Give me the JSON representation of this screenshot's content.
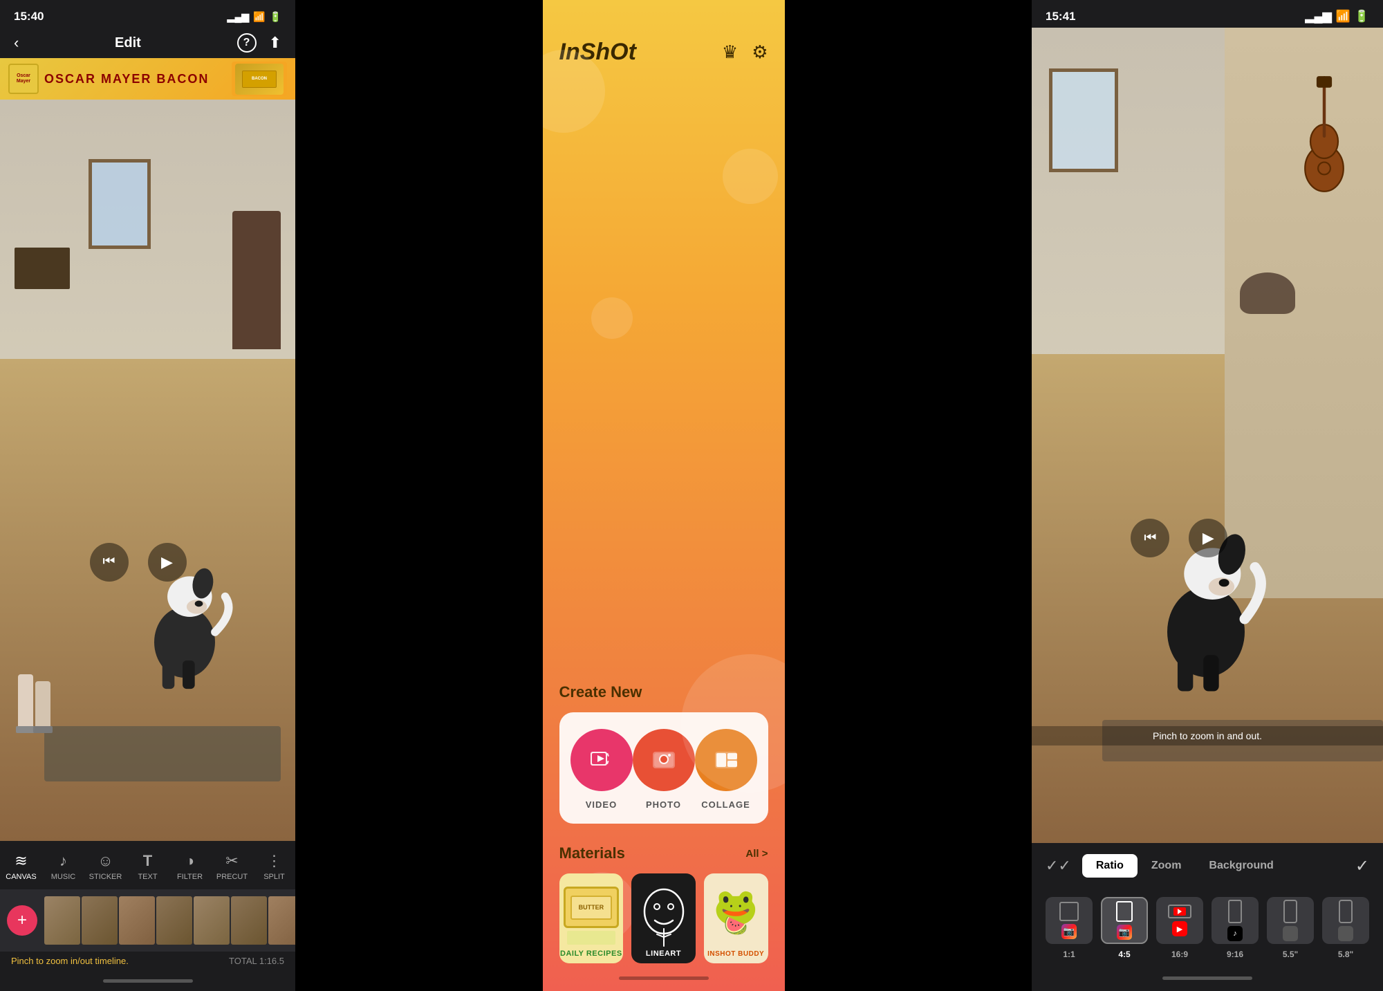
{
  "panel1": {
    "status": {
      "time": "15:40",
      "arrow": "↗"
    },
    "nav": {
      "back_icon": "‹",
      "title": "Edit",
      "help_icon": "?",
      "share_icon": "⬆"
    },
    "ad": {
      "brand": "Oscar Mayer",
      "text": "OSCAR  MAYER  BACON",
      "logo_text": "Oscar Mayer"
    },
    "controls": {
      "skip_back": "⏮",
      "play": "▶"
    },
    "toolbar": {
      "items": [
        {
          "id": "canvas",
          "icon": "≡",
          "label": "CANVAS",
          "active": true
        },
        {
          "id": "music",
          "icon": "♪",
          "label": "MUSIC"
        },
        {
          "id": "sticker",
          "icon": "☺",
          "label": "STICKER"
        },
        {
          "id": "text",
          "icon": "T",
          "label": "TEXT"
        },
        {
          "id": "filter",
          "icon": "◑",
          "label": "FILTER"
        },
        {
          "id": "precut",
          "icon": "✂",
          "label": "PRECUT"
        },
        {
          "id": "split",
          "icon": "⋮",
          "label": "SPLIT"
        }
      ]
    },
    "timeline": {
      "zoom_hint": "Pinch to zoom in/out timeline.",
      "total_time": "TOTAL 1:16.5"
    }
  },
  "panel2": {
    "status": {
      "time": "  "
    },
    "header": {
      "logo": "InShOt",
      "crown_icon": "♛",
      "settings_icon": "⚙"
    },
    "create_new": {
      "section_title": "Create New",
      "items": [
        {
          "id": "video",
          "icon": "▦",
          "label": "VIDEO"
        },
        {
          "id": "photo",
          "icon": "🖼",
          "label": "PHOTO"
        },
        {
          "id": "collage",
          "icon": "⊞",
          "label": "COLLAGE"
        }
      ]
    },
    "materials": {
      "section_title": "Materials",
      "all_link": "All >",
      "items": [
        {
          "id": "daily-recipes",
          "label": "DAILY RECIPES",
          "bg": "yellow"
        },
        {
          "id": "lineart",
          "label": "LINEART",
          "bg": "dark"
        },
        {
          "id": "inshot-buddy",
          "label": "INSHOT BUDDY",
          "bg": "cream"
        }
      ]
    }
  },
  "panel3": {
    "status": {
      "time": "15:41",
      "arrow": "↗"
    },
    "video": {
      "pinch_hint": "Pinch to zoom in and out."
    },
    "controls": {
      "skip_back": "⏮",
      "play": "▶"
    },
    "ratio_toolbar": {
      "double_check": "✓✓",
      "tabs": [
        {
          "id": "ratio",
          "label": "Ratio",
          "active": true
        },
        {
          "id": "zoom",
          "label": "Zoom"
        },
        {
          "id": "background",
          "label": "Background"
        }
      ],
      "confirm_icon": "✓"
    },
    "ratio_options": [
      {
        "id": "1x1",
        "label": "1:1",
        "selected": false,
        "platform": "instagram"
      },
      {
        "id": "4x5",
        "label": "4:5",
        "selected": true,
        "platform": "instagram"
      },
      {
        "id": "16x9",
        "label": "16:9",
        "selected": false,
        "platform": "youtube"
      },
      {
        "id": "9x16",
        "label": "9:16",
        "selected": false,
        "platform": "tiktok"
      },
      {
        "id": "5_5",
        "label": "5.5\"",
        "selected": false,
        "platform": "apple"
      },
      {
        "id": "5_8",
        "label": "5.8\"",
        "selected": false,
        "platform": "apple"
      }
    ]
  }
}
